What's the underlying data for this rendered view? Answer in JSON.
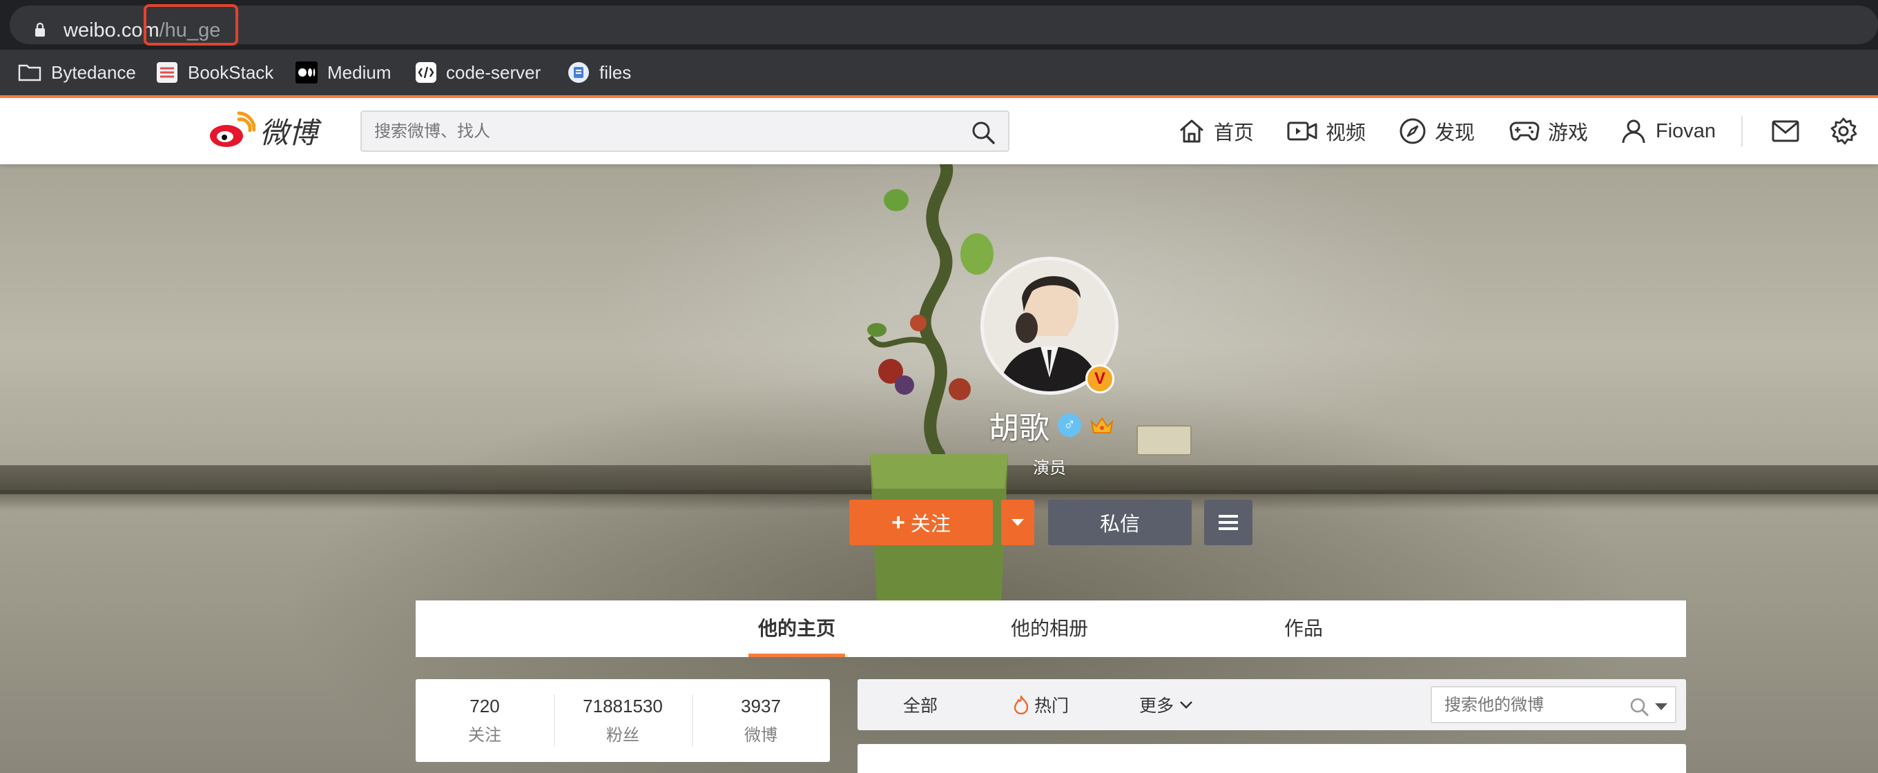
{
  "browser": {
    "url_host": "weibo.com",
    "url_path": "/hu_ge",
    "bookmarks": [
      {
        "label": "Bytedance",
        "icon": "folder-icon"
      },
      {
        "label": "BookStack",
        "icon": "bookstack-icon"
      },
      {
        "label": "Medium",
        "icon": "medium-icon"
      },
      {
        "label": "code-server",
        "icon": "code-server-icon"
      },
      {
        "label": "files",
        "icon": "files-icon"
      }
    ]
  },
  "weibo_nav": {
    "logo_text": "微博",
    "search_placeholder": "搜索微博、找人",
    "items": [
      {
        "label": "首页",
        "icon": "home-icon"
      },
      {
        "label": "视频",
        "icon": "video-icon"
      },
      {
        "label": "发现",
        "icon": "discover-compass-icon"
      },
      {
        "label": "游戏",
        "icon": "gamepad-icon"
      },
      {
        "label": "Fiovan",
        "icon": "user-icon"
      }
    ],
    "right_icons": [
      "mail-icon",
      "gear-icon"
    ]
  },
  "profile": {
    "name": "胡歌",
    "gender_symbol": "♂",
    "verified_mark": "V",
    "description": "演员",
    "follow_label": "关注",
    "follow_plus": "+",
    "message_label": "私信"
  },
  "tabs": [
    {
      "label": "他的主页",
      "active": true
    },
    {
      "label": "他的相册",
      "active": false
    },
    {
      "label": "作品",
      "active": false
    }
  ],
  "stats": [
    {
      "value": "720",
      "label": "关注"
    },
    {
      "value": "71881530",
      "label": "粉丝"
    },
    {
      "value": "3937",
      "label": "微博"
    }
  ],
  "feed_filter": {
    "all_label": "全部",
    "hot_label": "热门",
    "more_label": "更多",
    "search_placeholder": "搜索他的微博"
  },
  "colors": {
    "accent": "#fa7d3c",
    "follow_button": "#f06a2b",
    "dark_button": "#5b5f6b",
    "url_highlight": "#e2432d"
  }
}
